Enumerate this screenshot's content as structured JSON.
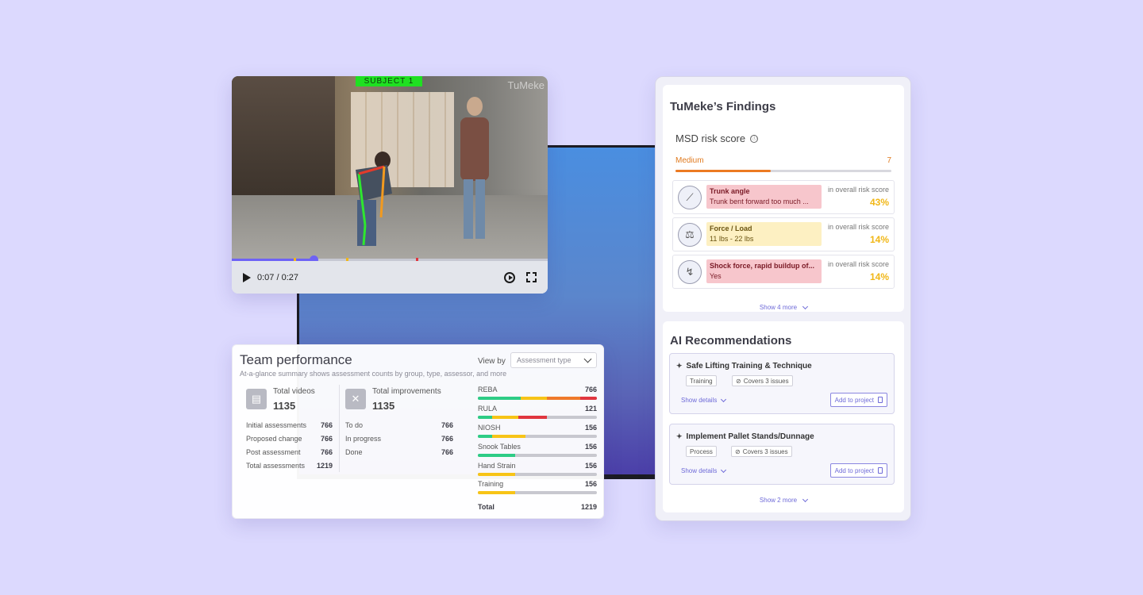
{
  "video": {
    "subject_tag": "SUBJECT 1",
    "watermark": "TuMeke",
    "time": "0:07 / 0:27",
    "progress": 0.26
  },
  "team": {
    "title": "Team performance",
    "subtitle": "At-a-glance summary shows assessment counts by group, type, assessor, and more",
    "view_by_label": "View by",
    "view_by_value": "Assessment type",
    "videos": {
      "label": "Total videos",
      "value": "1135",
      "rows": [
        {
          "label": "Initial assessments",
          "value": "766"
        },
        {
          "label": "Proposed change",
          "value": "766"
        },
        {
          "label": "Post assessment",
          "value": "766"
        },
        {
          "label": "Total assessments",
          "value": "1219"
        }
      ]
    },
    "improvements": {
      "label": "Total improvements",
      "value": "1135",
      "rows": [
        {
          "label": "To do",
          "value": "766"
        },
        {
          "label": "In progress",
          "value": "766"
        },
        {
          "label": "Done",
          "value": "766"
        }
      ]
    },
    "bars": [
      {
        "label": "REBA",
        "value": "766"
      },
      {
        "label": "RULA",
        "value": "121"
      },
      {
        "label": "NIOSH",
        "value": "156"
      },
      {
        "label": "Snook Tables",
        "value": "156"
      },
      {
        "label": "Hand Strain",
        "value": "156"
      },
      {
        "label": "Training",
        "value": "156"
      }
    ],
    "total_label": "Total",
    "total_value": "1219"
  },
  "findings": {
    "title": "TuMeke’s Findings",
    "msd_label": "MSD risk score",
    "info_icon": "ⓘ",
    "risk_level": "Medium",
    "risk_value": "7",
    "risk_fraction": 0.44,
    "items": [
      {
        "name": "Trunk angle",
        "desc": "Trunk bent forward too much ...",
        "note": "in overall risk score",
        "pct": "43%"
      },
      {
        "name": "Force / Load",
        "desc": "11 lbs - 22 lbs",
        "note": "in overall risk score",
        "pct": "14%"
      },
      {
        "name": "Shock force, rapid buildup of...",
        "desc": "Yes",
        "note": "in overall risk score",
        "pct": "14%"
      }
    ],
    "show_more": "Show 4 more"
  },
  "recommendations": {
    "title": "AI Recommendations",
    "items": [
      {
        "name": "Safe Lifting Training & Technique",
        "chip1": "Training",
        "chip2": "Covers 3 issues",
        "details": "Show details",
        "add": "Add to project"
      },
      {
        "name": "Implement Pallet Stands/Dunnage",
        "chip1": "Process",
        "chip2": "Covers 3 issues",
        "details": "Show details",
        "add": "Add to project"
      }
    ],
    "show_more": "Show 2 more"
  },
  "colors": {
    "accent": "#6e62f5",
    "risk_orange": "#ec7a22",
    "pct_yellow": "#f1b717",
    "tag_red": "#f7c6cc",
    "tag_yellow": "#fdf0c2",
    "bar_green": "#2ecc85",
    "bar_yellow": "#f7c417",
    "bar_orange": "#ef7a2a",
    "bar_red": "#e0363f"
  }
}
